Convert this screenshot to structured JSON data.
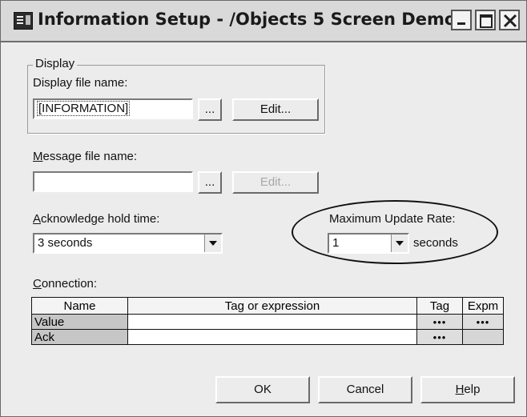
{
  "window": {
    "title": "Information Setup - /Objects 5 Screen Demo/"
  },
  "display_group": {
    "legend": "Display",
    "file_label": "Display file name:",
    "file_value": "[INFORMATION]",
    "browse_label": "...",
    "edit_label": "Edit..."
  },
  "message": {
    "label_accel": "M",
    "label_rest": "essage file name:",
    "file_value": "",
    "browse_label": "...",
    "edit_label": "Edit..."
  },
  "ack_hold": {
    "label_accel": "A",
    "label_rest": "cknowledge hold time:",
    "selected": "3 seconds"
  },
  "update_rate": {
    "label": "Maximum Update Rate:",
    "selected": "1",
    "unit": "seconds"
  },
  "connection": {
    "label_accel": "C",
    "label_rest": "onnection:",
    "columns": [
      "Name",
      "Tag or expression",
      "Tag",
      "Expm"
    ],
    "rows": [
      {
        "name": "Value",
        "expr": "",
        "tag_btn": "•••",
        "expr_btn": "•••"
      },
      {
        "name": "Ack",
        "expr": "",
        "tag_btn": "•••",
        "expr_btn": ""
      }
    ]
  },
  "buttons": {
    "ok": "OK",
    "cancel": "Cancel",
    "help_accel": "H",
    "help_rest": "elp"
  }
}
